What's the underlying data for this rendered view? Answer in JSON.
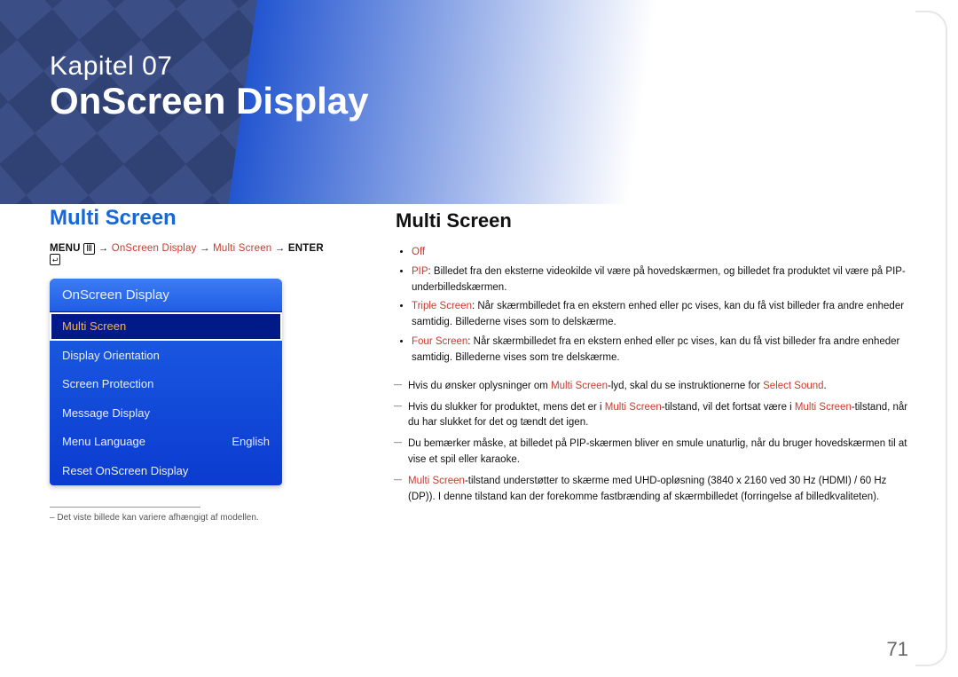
{
  "chapter": {
    "line": "Kapitel 07",
    "title": "OnScreen Display"
  },
  "left": {
    "section_title": "Multi Screen",
    "breadcrumb": {
      "prefix": "MENU",
      "parts": [
        "OnScreen Display",
        "Multi Screen"
      ],
      "suffix": "ENTER"
    },
    "menu": {
      "header": "OnScreen Display",
      "items": [
        {
          "label": "Multi Screen",
          "value": "",
          "selected": true
        },
        {
          "label": "Display Orientation",
          "value": ""
        },
        {
          "label": "Screen Protection",
          "value": ""
        },
        {
          "label": "Message Display",
          "value": ""
        },
        {
          "label": "Menu Language",
          "value": "English"
        },
        {
          "label": "Reset OnScreen Display",
          "value": ""
        }
      ]
    },
    "footnote": "Det viste billede kan variere afhængigt af modellen."
  },
  "right": {
    "title": "Multi Screen",
    "bullets": {
      "off": "Off",
      "pip_label": "PIP",
      "pip_text": ": Billedet fra den eksterne videokilde vil være på hovedskærmen, og billedet fra produktet vil være på PIP-underbilledskærmen.",
      "triple_label": "Triple Screen",
      "triple_text": ": Når skærmbilledet fra en ekstern enhed eller pc vises, kan du få vist billeder fra andre enheder samtidig. Billederne vises som to delskærme.",
      "four_label": "Four Screen",
      "four_text": ": Når skærmbilledet fra en ekstern enhed eller pc vises, kan du få vist billeder fra andre enheder samtidig. Billederne vises som tre delskærme."
    },
    "dashes": {
      "d1_pre": "Hvis du ønsker oplysninger om ",
      "d1_hl1": "Multi Screen",
      "d1_mid": "-lyd, skal du se instruktionerne for ",
      "d1_hl2": "Select Sound",
      "d1_end": ".",
      "d2_pre": "Hvis du slukker for produktet, mens det er i ",
      "d2_hl1": "Multi Screen",
      "d2_mid": "-tilstand, vil det fortsat være i ",
      "d2_hl2": "Multi Screen",
      "d2_end": "-tilstand, når du har slukket for det og tændt det igen.",
      "d3": "Du bemærker måske, at billedet på PIP-skærmen bliver en smule unaturlig, når du bruger hovedskærmen til at vise et spil eller karaoke.",
      "d4_hl": "Multi Screen",
      "d4_text": "-tilstand understøtter to skærme med UHD-opløsning (3840 x 2160 ved 30 Hz (HDMI) / 60 Hz (DP)). I denne tilstand kan der forekomme fastbrænding af skærmbilledet (forringelse af billedkvaliteten)."
    }
  },
  "page_number": "71"
}
